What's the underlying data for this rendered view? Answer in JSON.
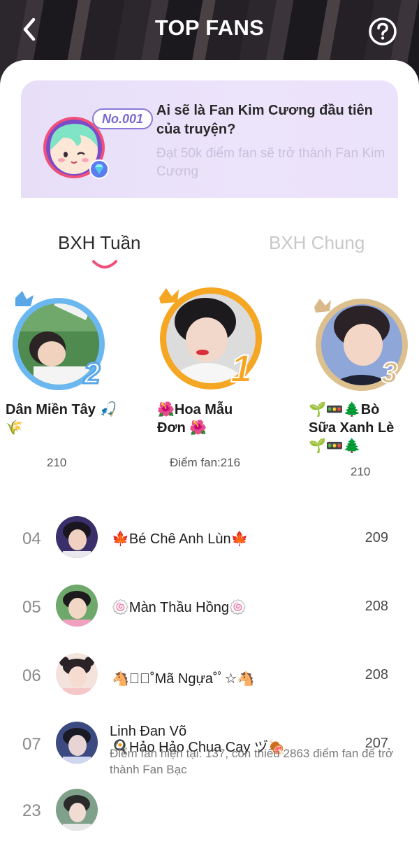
{
  "header": {
    "title": "TOP FANS"
  },
  "banner": {
    "badge": "No.001",
    "title": "Ai sẽ là Fan Kim Cương đầu tiên của truyện?",
    "subtitle": "Đạt 50k điểm fan sẽ trở thành Fan Kim Cương"
  },
  "tabs": [
    {
      "label": "BXH Tuần"
    },
    {
      "label": "BXH Chung"
    }
  ],
  "podium": [
    {
      "rank": "2",
      "name": "Dân Miền Tây 🎣🌾",
      "score": "210"
    },
    {
      "rank": "1",
      "name": "🌺Hoa Mẫu Đơn 🌺",
      "score": "Điểm fan:216"
    },
    {
      "rank": "3",
      "name": "🌱🚥🌲Bò Sữa Xanh Lè 🌱🚥🌲",
      "score": "210"
    }
  ],
  "list": [
    {
      "rank": "04",
      "name": "🍁Bé Chê Anh Lùn🍁",
      "score": "209"
    },
    {
      "rank": "05",
      "name": "🍥Màn Thầu Hồng🍥",
      "score": "208"
    },
    {
      "rank": "06",
      "name": "🐴☆ﾟ˚Mã Ngựa˚ﾟ☆🐴",
      "score": "208"
    },
    {
      "rank": "07",
      "name": "🍳Hảo Hảo Chua Cay ヅ🍖",
      "score": "207"
    }
  ],
  "me": {
    "rank": "23",
    "name": "Linh Đan Võ",
    "description": "Điểm fan hiện tại: 137, còn thiếu 2863 điểm fan để trở thành Fan Bạc"
  },
  "colors": {
    "accent": "#f0507a",
    "gold": "#f5a623",
    "silver": "#5aa7e8",
    "bronze": "#d9b98a",
    "banner": "#e9e0fa"
  },
  "icons": [
    "back-icon",
    "help-icon",
    "diamond-icon",
    "crown-icon"
  ]
}
